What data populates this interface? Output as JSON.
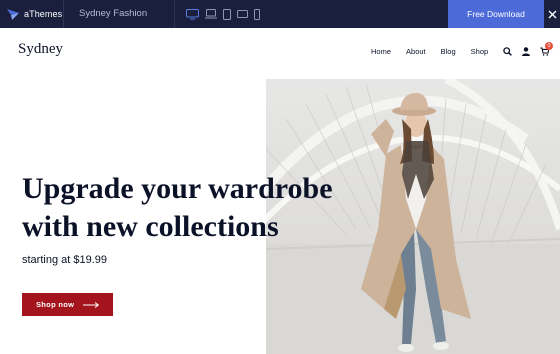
{
  "topbar": {
    "brand_name": "aThemes",
    "theme_name": "Sydney Fashion",
    "devices": [
      {
        "icon": "desktop-icon"
      },
      {
        "icon": "laptop-icon"
      },
      {
        "icon": "tablet-icon"
      },
      {
        "icon": "tablet-landscape-icon"
      },
      {
        "icon": "mobile-icon"
      }
    ],
    "download_label": "Free Download",
    "close_icon": "close-icon"
  },
  "header": {
    "logo_text": "Sydney",
    "nav": [
      "Home",
      "About",
      "Blog",
      "Shop"
    ],
    "icons": [
      "search-icon",
      "user-icon",
      "cart-icon"
    ],
    "cart_count": "0"
  },
  "hero": {
    "title_line1": "Upgrade your wardrobe",
    "title_line2": "with new collections",
    "subtitle": "starting at $19.99",
    "button_label": "Shop now",
    "image": "woman-in-trench-coat-photo"
  },
  "colors": {
    "topbar_bg": "#1a1f3d",
    "accent_blue": "#4c6bd8",
    "device_active": "#5b7be0",
    "button_red": "#a4141c",
    "text_dark": "#0b1227",
    "badge": "#e9503f"
  }
}
